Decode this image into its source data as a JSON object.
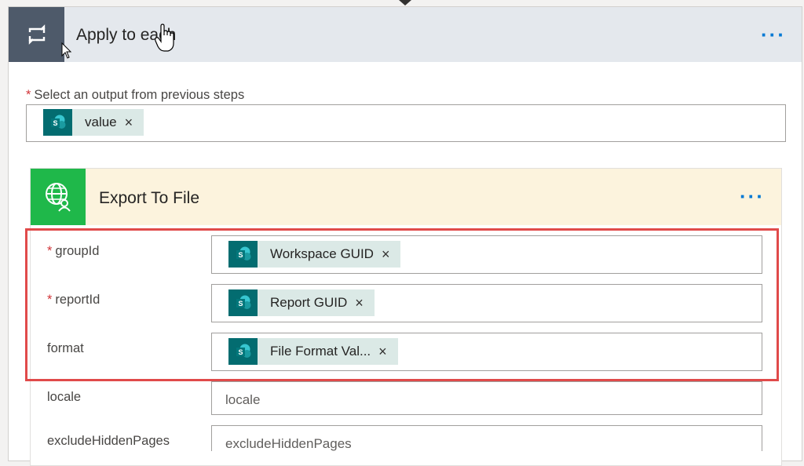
{
  "outer_action": {
    "title": "Apply to each",
    "more_label": "···",
    "select_label": "Select an output from previous steps",
    "select_token": {
      "icon": "sharepoint-icon",
      "label": "value",
      "remove": "×"
    }
  },
  "inner_action": {
    "title": "Export To File",
    "more_label": "···",
    "fields": [
      {
        "name": "groupId",
        "required": true,
        "token": "Workspace GUID",
        "remove": "×"
      },
      {
        "name": "reportId",
        "required": true,
        "token": "Report GUID",
        "remove": "×"
      },
      {
        "name": "format",
        "required": false,
        "token": "File Format Val...",
        "remove": "×"
      },
      {
        "name": "locale",
        "required": false,
        "placeholder": "locale"
      },
      {
        "name": "excludeHiddenPages",
        "required": false,
        "placeholder": "excludeHiddenPages"
      }
    ]
  },
  "required_marker": "*",
  "colors": {
    "loop_icon_bg": "#4e5a6a",
    "powerbi_icon_bg": "#1fb84a",
    "sharepoint_bg": "#036c70",
    "token_bg": "#dbe9e6",
    "highlight": "#e04a4a",
    "link_blue": "#0078d4"
  }
}
